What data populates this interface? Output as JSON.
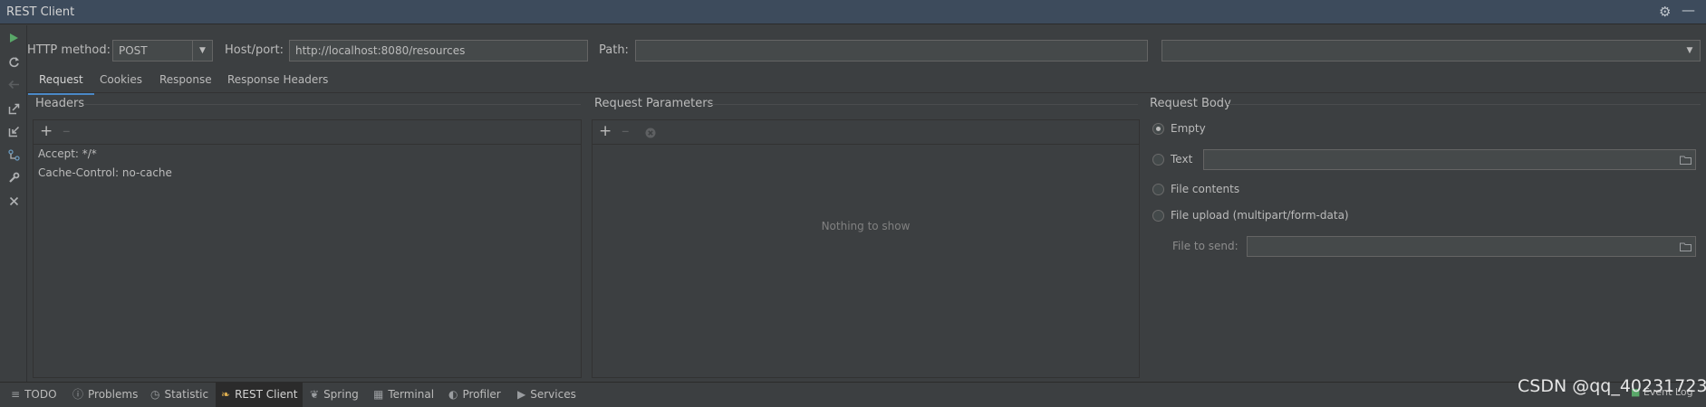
{
  "window": {
    "title": "REST Client"
  },
  "request_bar": {
    "method_label": "HTTP method:",
    "method_value": "POST",
    "host_label": "Host/port:",
    "host_value": "http://localhost:8080/resources",
    "path_label": "Path:",
    "path_value": "",
    "extra_combo_value": ""
  },
  "tabs": [
    {
      "label": "Request",
      "active": true
    },
    {
      "label": "Cookies",
      "active": false
    },
    {
      "label": "Response",
      "active": false
    },
    {
      "label": "Response Headers",
      "active": false
    }
  ],
  "headers": {
    "title": "Headers",
    "items": [
      "Accept: */*",
      "Cache-Control: no-cache"
    ]
  },
  "params": {
    "title": "Request Parameters",
    "empty_text": "Nothing to show"
  },
  "body": {
    "title": "Request Body",
    "options": {
      "empty": "Empty",
      "text": "Text",
      "file_contents": "File contents",
      "file_upload": "File upload (multipart/form-data)"
    },
    "selected": "Empty",
    "text_value": "",
    "file_to_send_label": "File to send:",
    "file_to_send_value": ""
  },
  "icons": {
    "settings": "gear-icon",
    "minimize": "minimize-icon",
    "run": "run-icon",
    "refresh": "refresh-icon",
    "back": "back-arrow-icon",
    "export": "export-icon",
    "import": "import-icon",
    "compare": "compare-icon",
    "wrench": "wrench-icon",
    "close": "close-icon",
    "add": "plus-icon",
    "remove": "minus-icon",
    "clear": "clear-icon",
    "folder": "folder-icon"
  },
  "bottom_tabs": [
    {
      "label": "TODO",
      "icon": "list-icon",
      "active": false
    },
    {
      "label": "Problems",
      "icon": "info-icon",
      "active": false
    },
    {
      "label": "Statistic",
      "icon": "statistic-icon",
      "active": false
    },
    {
      "label": "REST Client",
      "icon": "rest-client-icon",
      "active": true
    },
    {
      "label": "Spring",
      "icon": "spring-leaf-icon",
      "active": false
    },
    {
      "label": "Terminal",
      "icon": "terminal-icon",
      "active": false
    },
    {
      "label": "Profiler",
      "icon": "profiler-icon",
      "active": false
    },
    {
      "label": "Services",
      "icon": "services-icon",
      "active": false
    }
  ],
  "status": {
    "event_log": "Event Log",
    "watermark": "CSDN @qq_40231723"
  },
  "colors": {
    "background": "#3c3f41",
    "title_bar": "#3d4b5c",
    "accent": "#4a88c7",
    "run_green": "#59a869"
  }
}
